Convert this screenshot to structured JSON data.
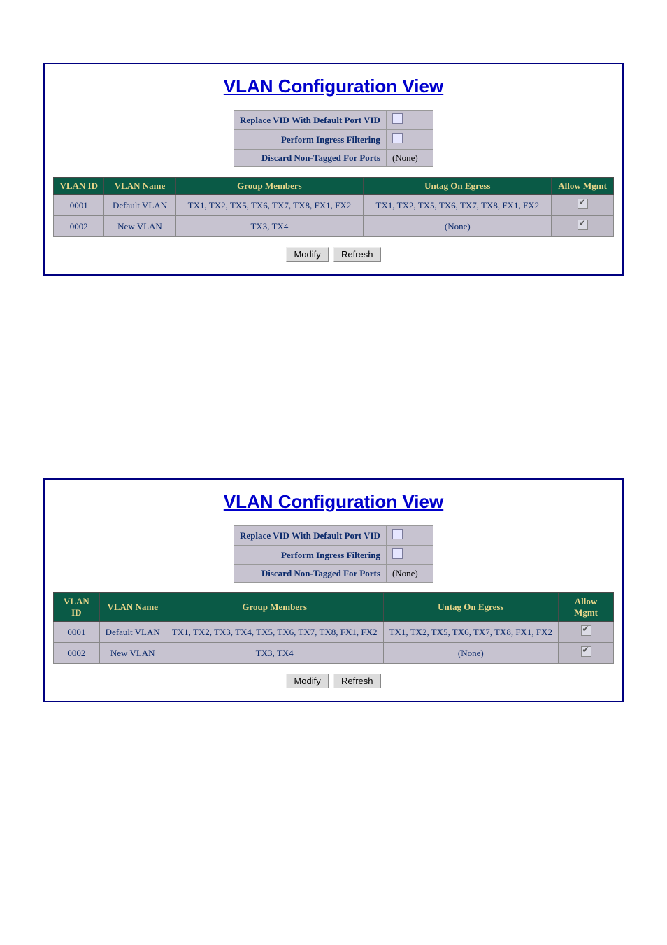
{
  "panels": [
    {
      "title": "VLAN Configuration View",
      "settings": [
        {
          "label": "Replace VID With Default Port VID",
          "type": "checkbox_off",
          "value": ""
        },
        {
          "label": "Perform Ingress Filtering",
          "type": "checkbox_off",
          "value": ""
        },
        {
          "label": "Discard Non-Tagged For Ports",
          "type": "text",
          "value": "(None)"
        }
      ],
      "headers": {
        "vlan_id": "VLAN ID",
        "vlan_name": "VLAN Name",
        "group_members": "Group Members",
        "untag_on_egress": "Untag On Egress",
        "allow_mgmt": "Allow Mgmt"
      },
      "rows": [
        {
          "vlan_id": "0001",
          "vlan_name": "Default VLAN",
          "group_members": "TX1, TX2, TX5, TX6, TX7, TX8, FX1, FX2",
          "untag_on_egress": "TX1, TX2, TX5, TX6, TX7, TX8, FX1, FX2",
          "allow_mgmt": true
        },
        {
          "vlan_id": "0002",
          "vlan_name": "New VLAN",
          "group_members": "TX3, TX4",
          "untag_on_egress": "(None)",
          "allow_mgmt": true
        }
      ],
      "buttons": {
        "modify": "Modify",
        "refresh": "Refresh"
      }
    },
    {
      "title": "VLAN Configuration View",
      "settings": [
        {
          "label": "Replace VID With Default Port VID",
          "type": "checkbox_off",
          "value": ""
        },
        {
          "label": "Perform Ingress Filtering",
          "type": "checkbox_off",
          "value": ""
        },
        {
          "label": "Discard Non-Tagged For Ports",
          "type": "text",
          "value": "(None)"
        }
      ],
      "headers": {
        "vlan_id": "VLAN ID",
        "vlan_name": "VLAN Name",
        "group_members": "Group Members",
        "untag_on_egress": "Untag On Egress",
        "allow_mgmt": "Allow Mgmt"
      },
      "rows": [
        {
          "vlan_id": "0001",
          "vlan_name": "Default VLAN",
          "group_members": "TX1, TX2, TX3, TX4, TX5, TX6, TX7, TX8, FX1, FX2",
          "untag_on_egress": "TX1, TX2, TX5, TX6, TX7, TX8, FX1, FX2",
          "allow_mgmt": true
        },
        {
          "vlan_id": "0002",
          "vlan_name": "New VLAN",
          "group_members": "TX3, TX4",
          "untag_on_egress": "(None)",
          "allow_mgmt": true
        }
      ],
      "buttons": {
        "modify": "Modify",
        "refresh": "Refresh"
      }
    }
  ]
}
